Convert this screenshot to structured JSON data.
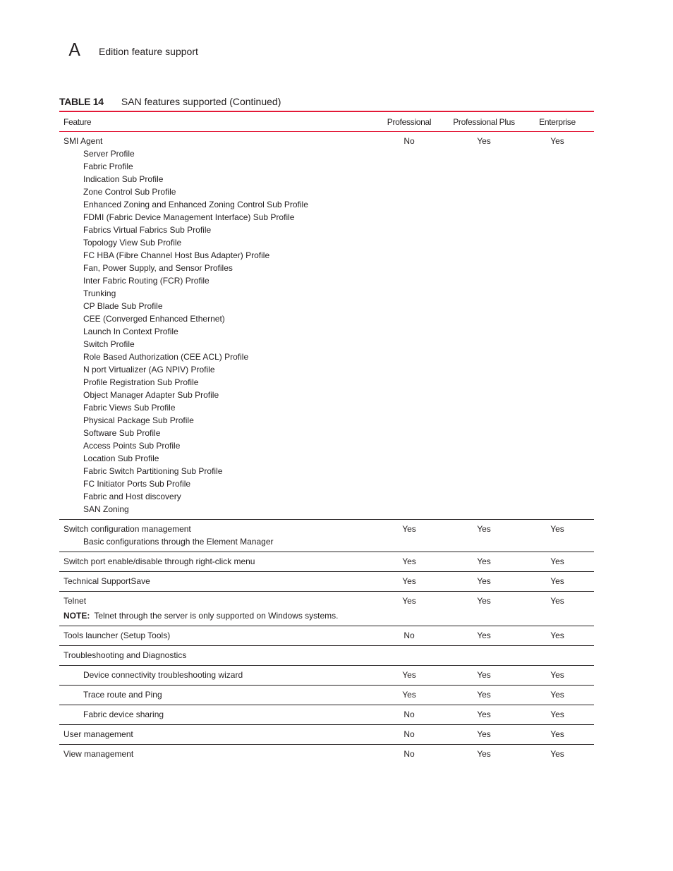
{
  "header": {
    "chapter_letter": "A",
    "chapter_title": "Edition feature support"
  },
  "table": {
    "caption_number": "TABLE 14",
    "caption_title": "SAN features supported (Continued)",
    "accent_color": "#e31837",
    "columns": [
      "Feature",
      "Professional",
      "Professional Plus",
      "Enterprise"
    ],
    "rows": [
      {
        "feature": "SMI Agent",
        "sub_items": [
          "Server Profile",
          "Fabric Profile",
          "Indication Sub Profile",
          "Zone Control Sub Profile",
          "Enhanced Zoning and Enhanced Zoning Control Sub Profile",
          "FDMI (Fabric Device Management Interface) Sub Profile",
          "Fabrics Virtual Fabrics Sub Profile",
          "Topology View Sub Profile",
          "FC HBA (Fibre Channel Host Bus Adapter) Profile",
          "Fan, Power Supply, and Sensor Profiles",
          "Inter Fabric Routing (FCR) Profile",
          "Trunking",
          "CP Blade Sub Profile",
          "CEE (Converged Enhanced Ethernet)",
          "Launch In Context Profile",
          "Switch Profile",
          "Role Based Authorization (CEE ACL) Profile",
          "N port Virtualizer (AG NPIV) Profile",
          "Profile Registration Sub Profile",
          "Object Manager Adapter Sub Profile",
          "Fabric Views Sub Profile",
          "Physical Package Sub Profile",
          "Software Sub Profile",
          "Access Points Sub Profile",
          "Location Sub Profile",
          "Fabric Switch Partitioning Sub Profile",
          "FC Initiator Ports Sub Profile",
          "Fabric and Host discovery",
          "SAN Zoning"
        ],
        "professional": "No",
        "professional_plus": "Yes",
        "enterprise": "Yes"
      },
      {
        "feature": "Switch configuration management",
        "sub_items": [
          "Basic configurations through the Element Manager"
        ],
        "professional": "Yes",
        "professional_plus": "Yes",
        "enterprise": "Yes"
      },
      {
        "feature": "Switch port enable/disable through right-click menu",
        "professional": "Yes",
        "professional_plus": "Yes",
        "enterprise": "Yes"
      },
      {
        "feature": "Technical SupportSave",
        "professional": "Yes",
        "professional_plus": "Yes",
        "enterprise": "Yes"
      },
      {
        "feature": "Telnet",
        "note_label": "NOTE:",
        "note_text": "Telnet through the server is only supported on Windows systems.",
        "professional": "Yes",
        "professional_plus": "Yes",
        "enterprise": "Yes"
      },
      {
        "feature": "Tools launcher (Setup Tools)",
        "professional": "No",
        "professional_plus": "Yes",
        "enterprise": "Yes"
      },
      {
        "feature": "Troubleshooting and Diagnostics",
        "professional": "",
        "professional_plus": "",
        "enterprise": ""
      },
      {
        "feature": "Device connectivity troubleshooting wizard",
        "indent": true,
        "professional": "Yes",
        "professional_plus": "Yes",
        "enterprise": "Yes"
      },
      {
        "feature": "Trace route and Ping",
        "indent": true,
        "professional": "Yes",
        "professional_plus": "Yes",
        "enterprise": "Yes"
      },
      {
        "feature": "Fabric device sharing",
        "indent": true,
        "professional": "No",
        "professional_plus": "Yes",
        "enterprise": "Yes"
      },
      {
        "feature": "User management",
        "professional": "No",
        "professional_plus": "Yes",
        "enterprise": "Yes"
      },
      {
        "feature": "View management",
        "professional": "No",
        "professional_plus": "Yes",
        "enterprise": "Yes"
      }
    ]
  }
}
